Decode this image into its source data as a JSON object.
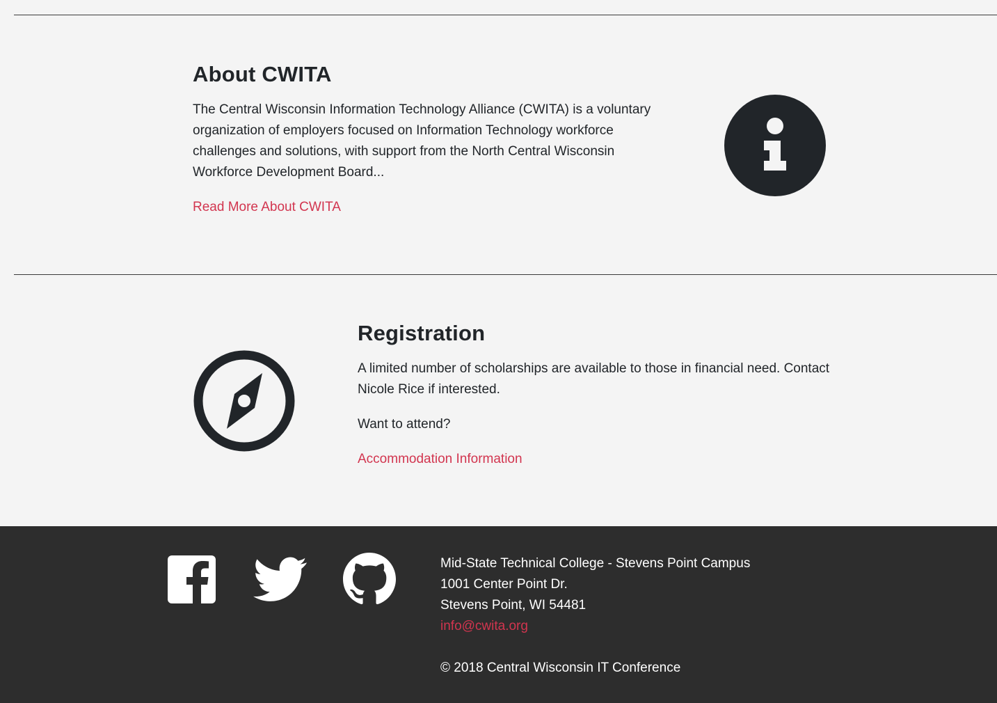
{
  "about": {
    "title": "About CWITA",
    "text": "The Central Wisconsin Information Technology Alliance (CWITA) is a voluntary organization of employers focused on Information Technology workforce challenges and solutions, with support from the North Central Wisconsin Workforce Development Board...",
    "link_label": "Read More About CWITA",
    "icon": "info-circle-icon"
  },
  "registration": {
    "title": "Registration",
    "text": "A limited number of scholarships are available to those in financial need. Contact Nicole Rice if interested.",
    "attend_text": "Want to attend?",
    "link_label": "Accommodation Information",
    "icon": "compass-icon"
  },
  "footer": {
    "social": [
      "facebook-icon",
      "twitter-icon",
      "github-icon"
    ],
    "address": {
      "line1": "Mid-State Technical College - Stevens Point Campus",
      "line2": "1001 Center Point Dr.",
      "line3": "Stevens Point, WI 54481",
      "email": "info@cwita.org"
    },
    "copyright": "© 2018 Central Wisconsin IT Conference"
  },
  "colors": {
    "background": "#f4f4f4",
    "text": "#212529",
    "link": "#d2354f",
    "footer_background": "#2d2d2d",
    "footer_text": "#ffffff"
  }
}
